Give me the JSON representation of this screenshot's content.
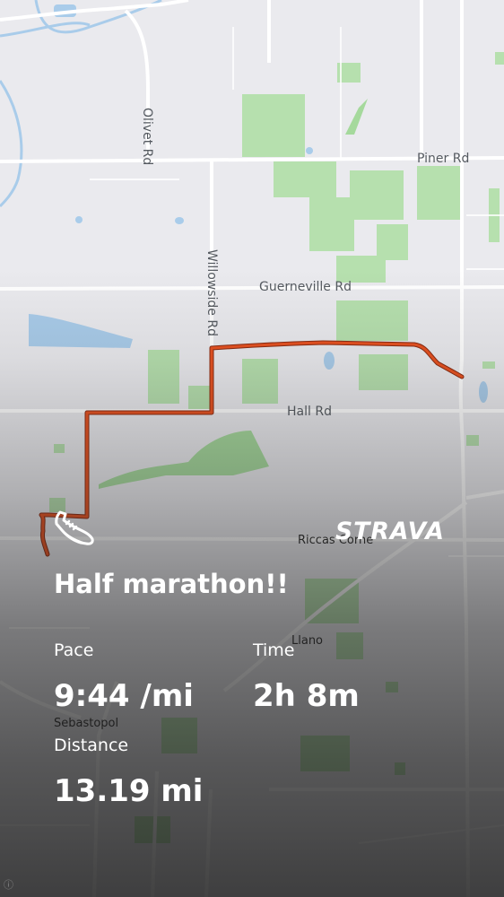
{
  "map": {
    "roads": {
      "olivet": "Olivet Rd",
      "piner": "Piner Rd",
      "willowside": "Willowside Rd",
      "guerneville": "Guerneville Rd",
      "hall": "Hall Rd",
      "riccas": "Riccas Corne",
      "llano": "Llano"
    },
    "town": "Sebastopol",
    "route_color": "#e8511f",
    "park_color": "#a8dba0",
    "water_color": "#a9ccea"
  },
  "brand": {
    "name": "STRAVA"
  },
  "activity": {
    "title": "Half marathon!!",
    "pace_label": "Pace",
    "pace_value": "9:44 /mi",
    "time_label": "Time",
    "time_value": "2h 8m",
    "distance_label": "Distance",
    "distance_value": "13.19 mi"
  },
  "icons": {
    "activity_type": "running-shoe-icon",
    "attribution": "info-icon"
  }
}
